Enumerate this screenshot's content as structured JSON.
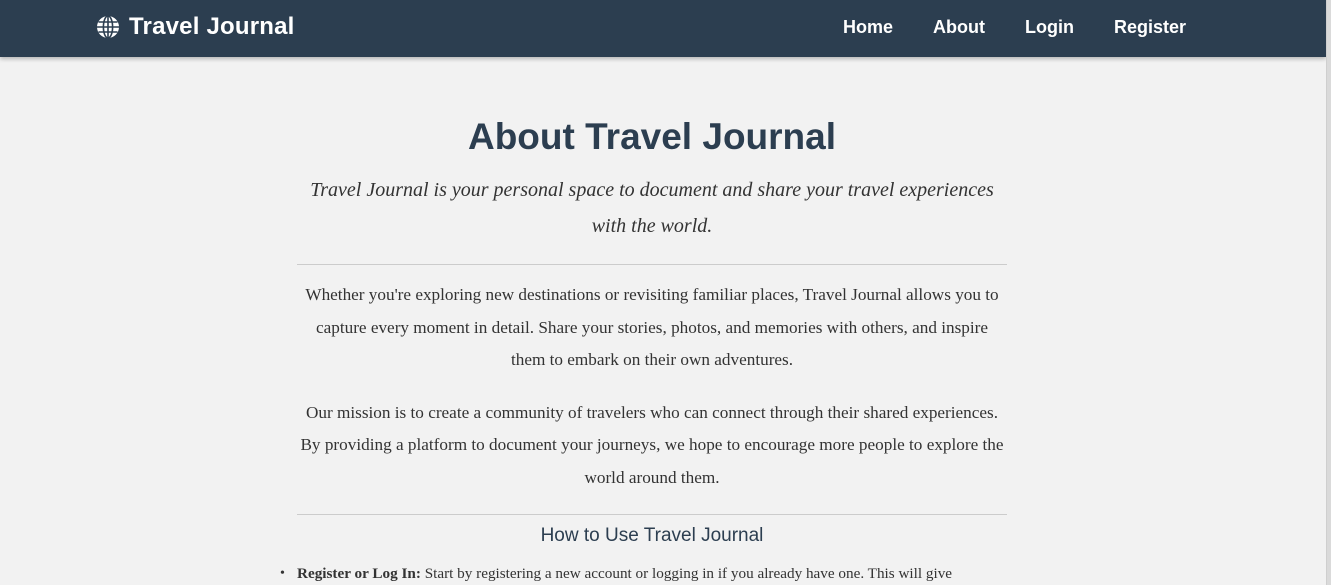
{
  "navbar": {
    "brand": "Travel Journal",
    "brand_icon": "globe-icon",
    "background": "#2c3e50",
    "links": [
      "Home",
      "About",
      "Login",
      "Register"
    ]
  },
  "main": {
    "title": "About Travel Journal",
    "tagline": "Travel Journal is your personal space to document and share your travel experiences with the world.",
    "paragraphs": [
      "Whether you're exploring new destinations or revisiting familiar places, Travel Journal allows you to capture every moment in detail. Share your stories, photos, and memories with others, and inspire them to embark on their own adventures.",
      "Our mission is to create a community of travelers who can connect through their shared experiences. By providing a platform to document your journeys, we hope to encourage more people to explore the world around them."
    ],
    "how_to_heading": "How to Use Travel Journal",
    "steps": [
      {
        "label": "Register or Log In:",
        "text": "Start by registering a new account or logging in if you already have one. This will give"
      }
    ]
  },
  "colors": {
    "heading": "#2c3e50",
    "body_text": "#333333",
    "page_background": "#f2f2f2"
  }
}
